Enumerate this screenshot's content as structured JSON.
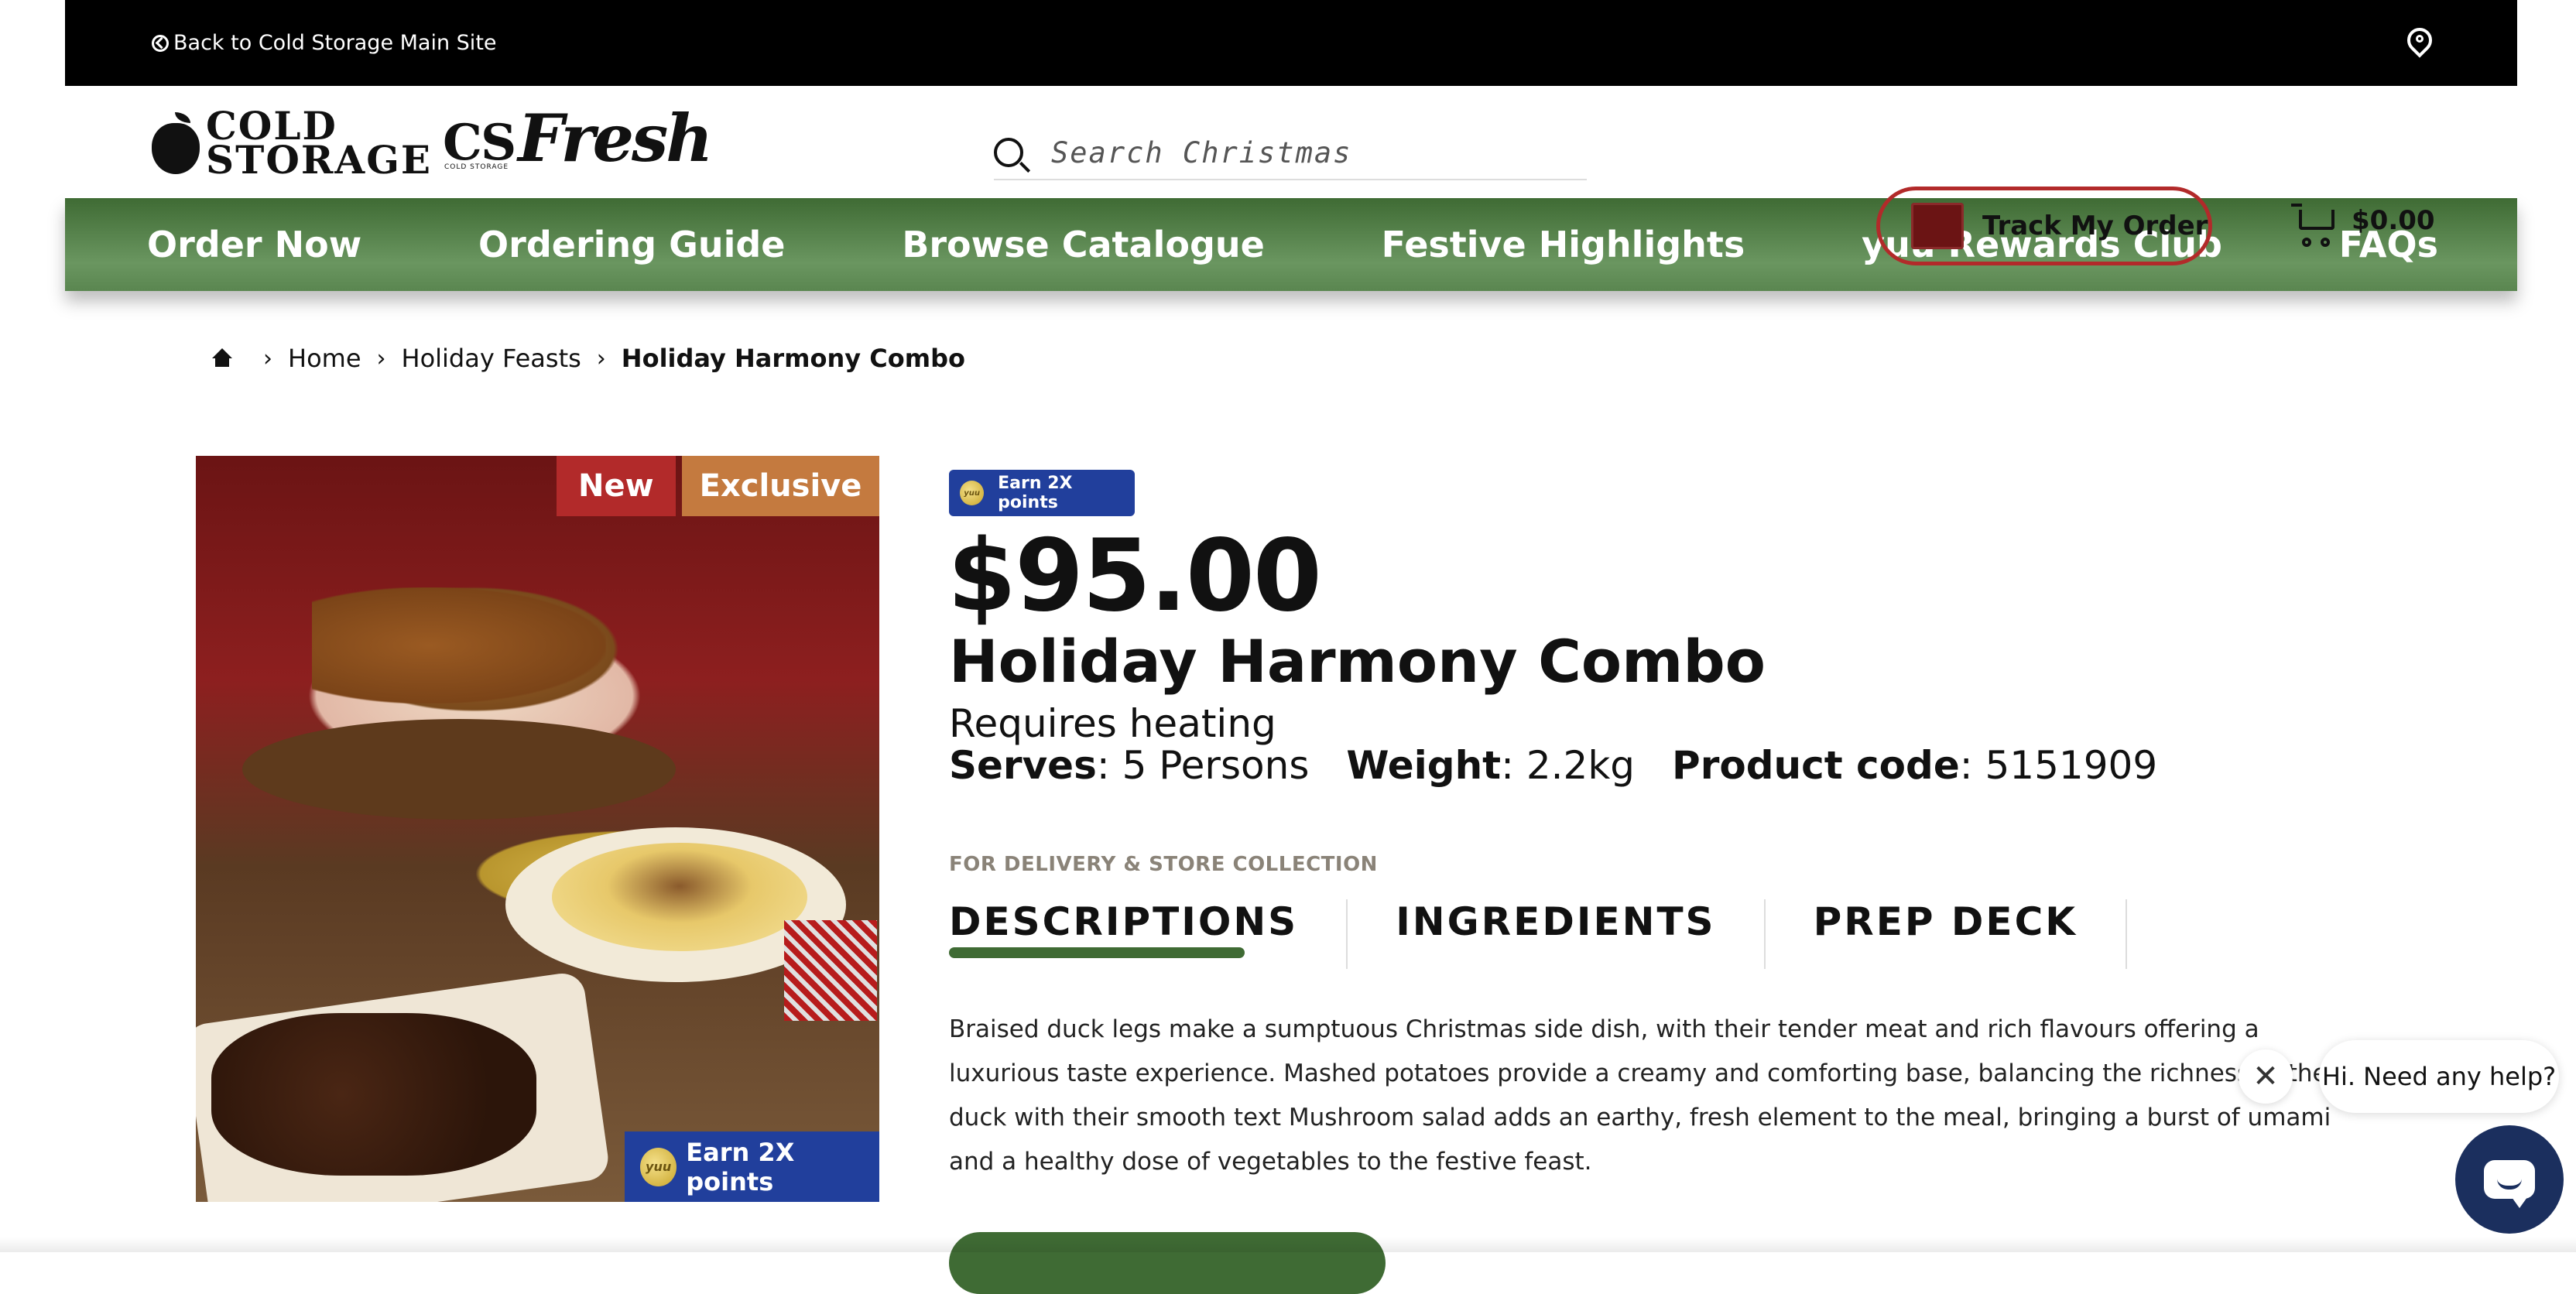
{
  "topbar": {
    "back_label": "Back to Cold Storage Main Site",
    "location_icon": "map-pin-icon"
  },
  "header": {
    "logo_cold": "COLD",
    "logo_storage": "STORAGE",
    "logo_cs": "CS",
    "logo_fresh": "Fresh",
    "logo_tiny": "COLD STORAGE",
    "search_placeholder": "Search Christmas",
    "track_order_label": "Track My Order",
    "cart_total": "$0.00"
  },
  "nav": {
    "items": [
      "Order Now",
      "Ordering Guide",
      "Browse Catalogue",
      "Festive Highlights",
      "yuu Rewards Club",
      "FAQs"
    ]
  },
  "breadcrumb": {
    "home": "Home",
    "category": "Holiday Feasts",
    "current": "Holiday Harmony Combo"
  },
  "product": {
    "badge_new": "New",
    "badge_exclusive": "Exclusive",
    "image_earn": "Earn 2X points",
    "earn_badge": "Earn 2X points",
    "yuu": "yuu",
    "price": "$95.00",
    "name": "Holiday Harmony Combo",
    "heating": "Requires heating",
    "serves_label": "Serves",
    "serves_value": ": 5 Persons",
    "weight_label": "Weight",
    "weight_value": ": 2.2kg",
    "code_label": "Product code",
    "code_value": ": 5151909",
    "delivery_note": "FOR DELIVERY & STORE COLLECTION",
    "tabs": [
      "DESCRIPTIONS",
      "INGREDIENTS",
      "PREP DECK"
    ],
    "description": "Braised duck legs make a sumptuous Christmas side dish, with their tender meat and rich flavours offering a luxurious taste experience. Mashed potatoes provide a creamy and comforting base, balancing the richness of the duck with their smooth text Mushroom salad adds an earthy, fresh element to the meal, bringing a burst of umami and a healthy dose of vegetables to the festive feast."
  },
  "chat": {
    "greeting": "Hi. Need any help?",
    "close": "✕"
  },
  "colors": {
    "nav_green": "#3f6b34",
    "accent_red": "#b22a2a",
    "yuu_blue": "#213f9c",
    "chat_navy": "#1b2f5e"
  }
}
